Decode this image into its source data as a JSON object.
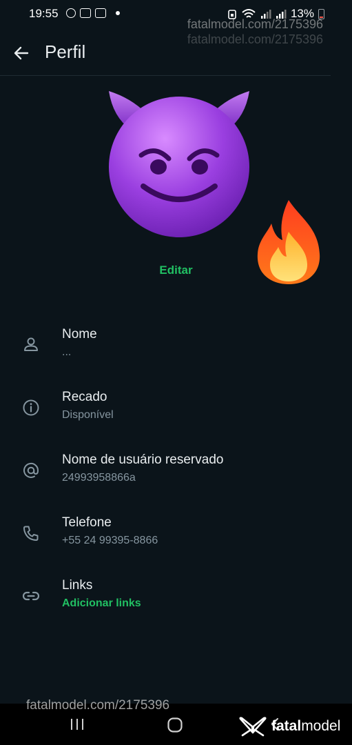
{
  "status_bar": {
    "time": "19:55",
    "battery": "13%",
    "left_icons": [
      "sync-icon",
      "app-notification-icon",
      "app-notification-icon"
    ],
    "right_icons": [
      "alarm-icon",
      "wifi-icon",
      "signal-icon",
      "signal-icon",
      "battery-icon"
    ]
  },
  "watermark": {
    "top": "fatalmodel.com/2175396",
    "top_ghost": "fatalmodel.com/2175396",
    "bottom": "fatalmodel.com/2175396",
    "brand_bold": "fatal",
    "brand_rest": "model"
  },
  "header": {
    "title": "Perfil",
    "back_icon": "arrow-left-icon"
  },
  "profile": {
    "avatar": "smiling-devil-emoji",
    "sticker": "fire-emoji",
    "edit_label": "Editar"
  },
  "fields": [
    {
      "icon": "person-icon",
      "label": "Nome",
      "value": "..."
    },
    {
      "icon": "info-icon",
      "label": "Recado",
      "value": "Disponível"
    },
    {
      "icon": "at-icon",
      "label": "Nome de usuário reservado",
      "value": "24993958866a"
    },
    {
      "icon": "phone-icon",
      "label": "Telefone",
      "value": "+55 24 99395-8866"
    },
    {
      "icon": "link-icon",
      "label": "Links",
      "value": "Adicionar links"
    }
  ],
  "colors": {
    "background": "#0b141a",
    "accent": "#21c063",
    "primary_text": "#e9edef",
    "secondary_text": "#8696a0"
  }
}
